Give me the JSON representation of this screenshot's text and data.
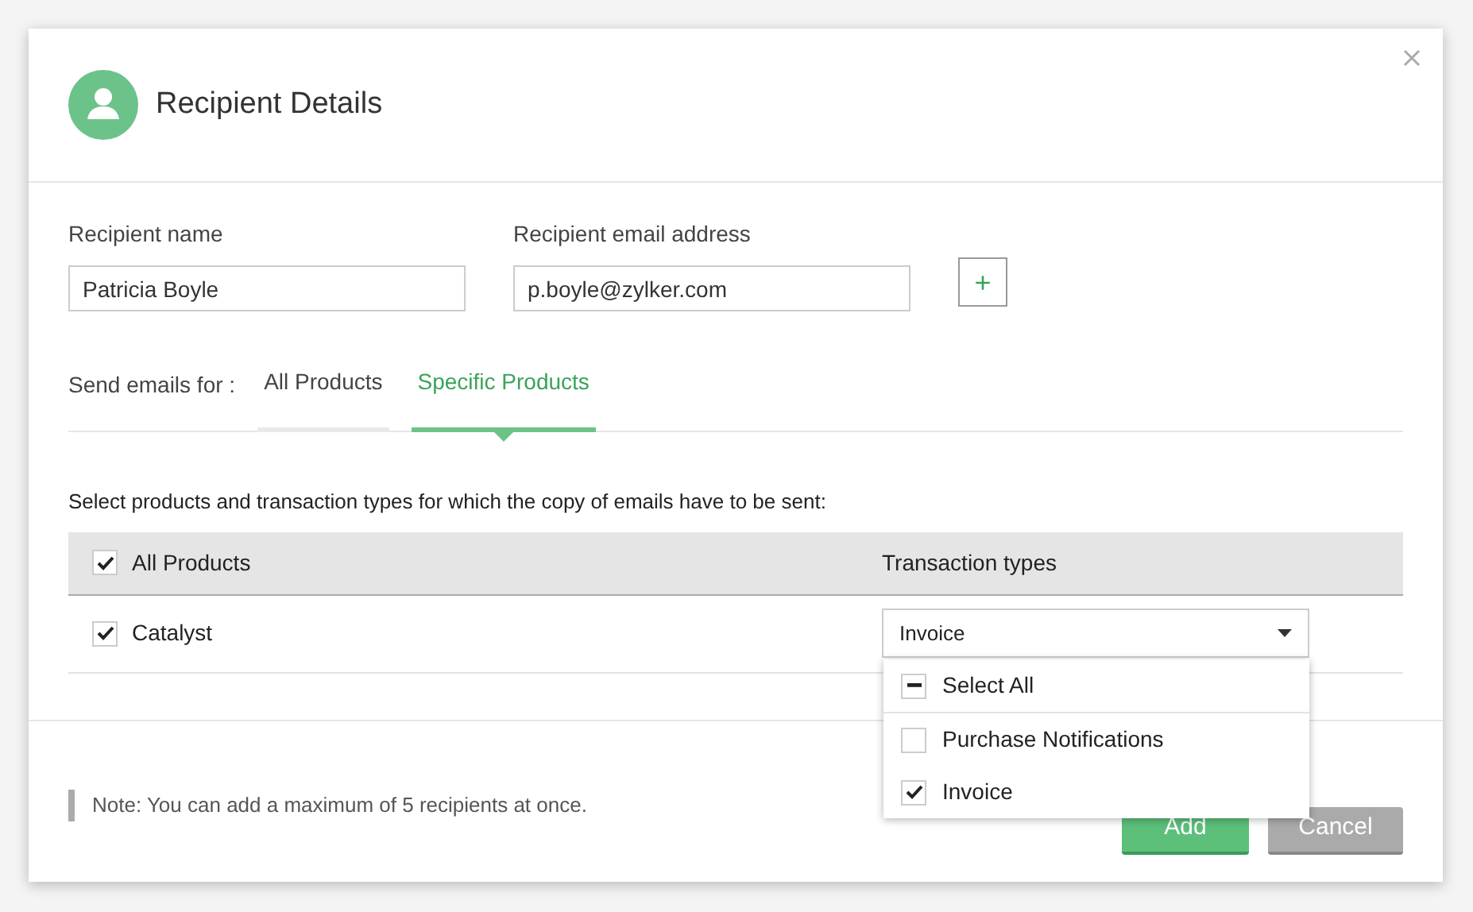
{
  "dialog": {
    "title": "Recipient Details"
  },
  "fields": [
    {
      "label": "Recipient name",
      "value": "Patricia Boyle"
    },
    {
      "label": "Recipient email address",
      "value": "p.boyle@zylker.com"
    }
  ],
  "add_recipient_button": "+",
  "send_for": {
    "label": "Send emails for :",
    "tabs": [
      {
        "label": "All Products",
        "selected": false
      },
      {
        "label": "Specific Products",
        "selected": true
      }
    ]
  },
  "instruction": "Select products and transaction types for which the copy of emails have to be sent:",
  "table": {
    "header": {
      "label": "All Products",
      "checked": true
    },
    "column_2": "Transaction types",
    "rows": [
      {
        "product": "Catalyst",
        "checked": true,
        "transaction_type": "Invoice"
      }
    ]
  },
  "dropdown": {
    "expanded": true,
    "select_all": {
      "label": "Select All",
      "indeterminate": true
    },
    "options": [
      {
        "label": "Purchase Notifications",
        "checked": false
      },
      {
        "label": "Invoice",
        "checked": true
      }
    ]
  },
  "note": "Note: You can add a maximum of 5 recipients at once.",
  "buttons": [
    {
      "label": "Add",
      "kind": "primary"
    },
    {
      "label": "Cancel",
      "kind": "secondary"
    }
  ]
}
